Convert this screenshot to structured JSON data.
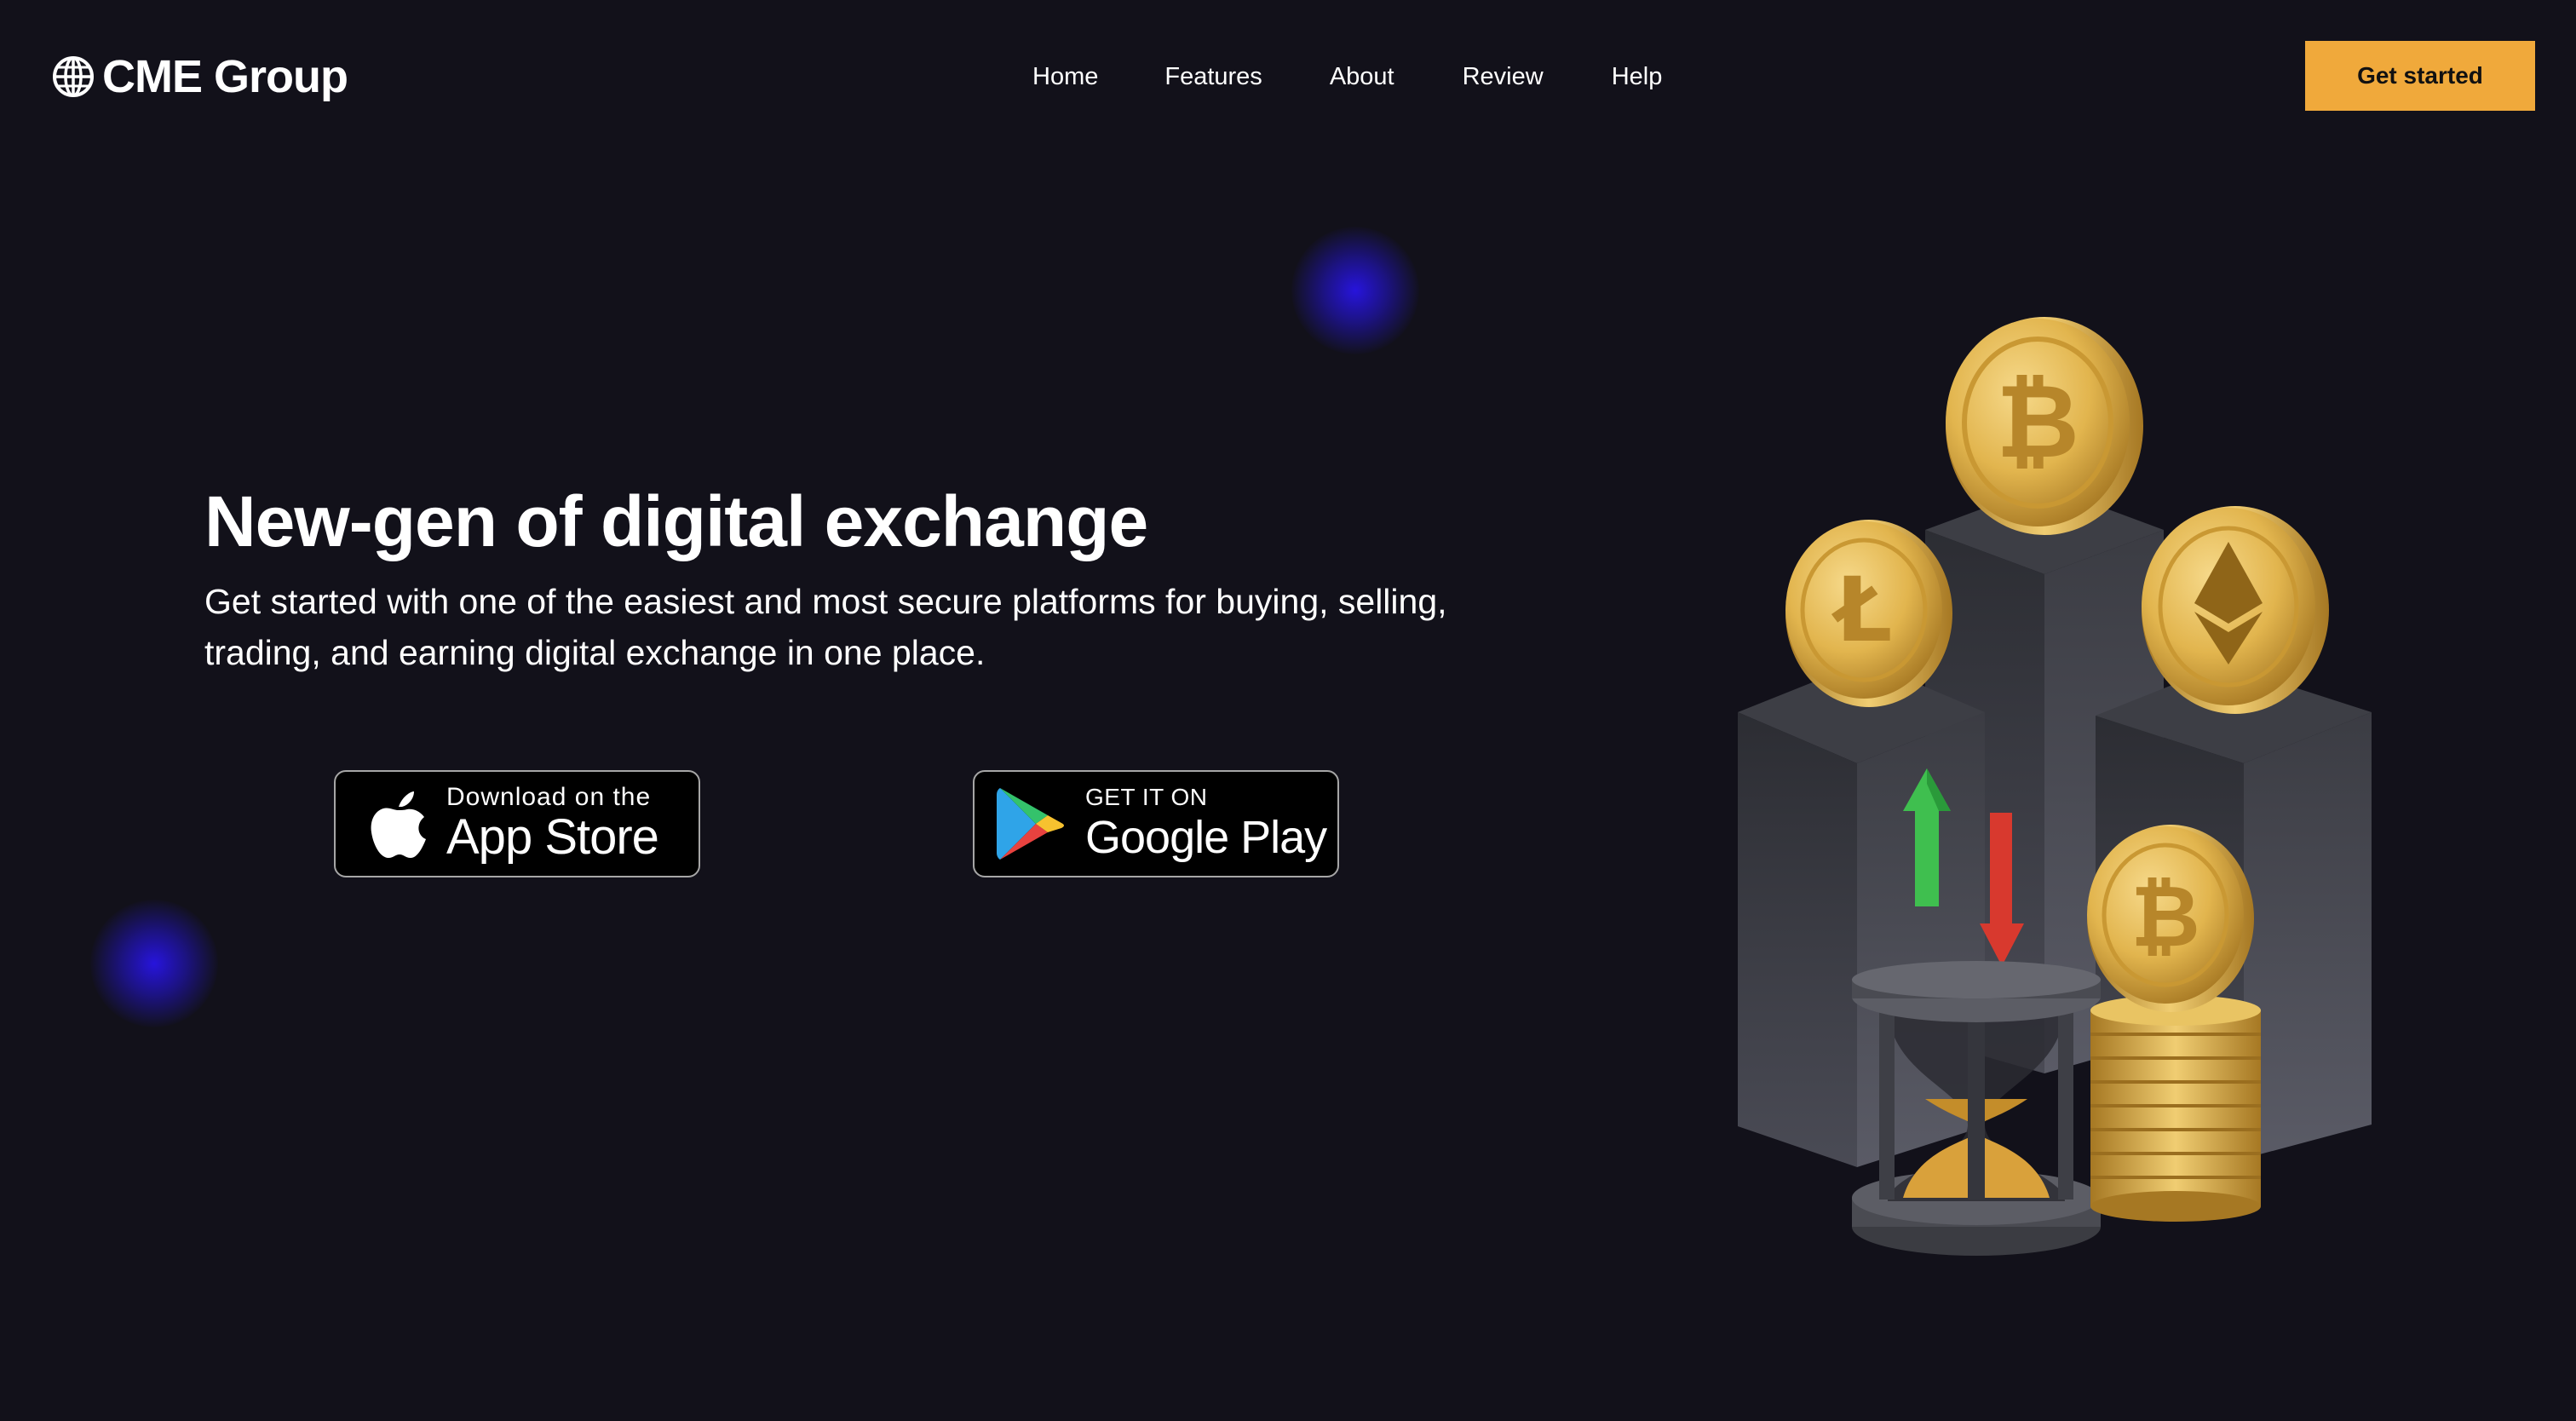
{
  "header": {
    "logo_text": "CME Group",
    "logo_icon": "globe-icon",
    "nav": [
      {
        "label": "Home"
      },
      {
        "label": "Features"
      },
      {
        "label": "About"
      },
      {
        "label": "Review"
      },
      {
        "label": "Help"
      }
    ],
    "cta_label": "Get started"
  },
  "hero": {
    "title": "New-gen of digital exchange",
    "subtitle": "Get started with one of the easiest and most secure platforms for buying, selling, trading, and earning digital exchange in one place."
  },
  "store_badges": {
    "app_store": {
      "icon": "apple-icon",
      "small_text": "Download on the",
      "large_text": "App Store"
    },
    "google_play": {
      "icon": "google-play-icon",
      "small_text": "GET IT ON",
      "large_text": "Google Play"
    }
  },
  "illustration": {
    "coins": [
      "bitcoin-coin-icon",
      "litecoin-coin-icon",
      "ethereum-coin-icon",
      "bitcoin-coin-icon"
    ],
    "extras": [
      "up-arrow-icon",
      "down-arrow-icon",
      "hourglass-icon",
      "coin-stack-icon"
    ]
  },
  "colors": {
    "background": "#12111a",
    "accent": "#f0a93b",
    "glow": "#2a18e0",
    "gold": "#e4b84e"
  }
}
